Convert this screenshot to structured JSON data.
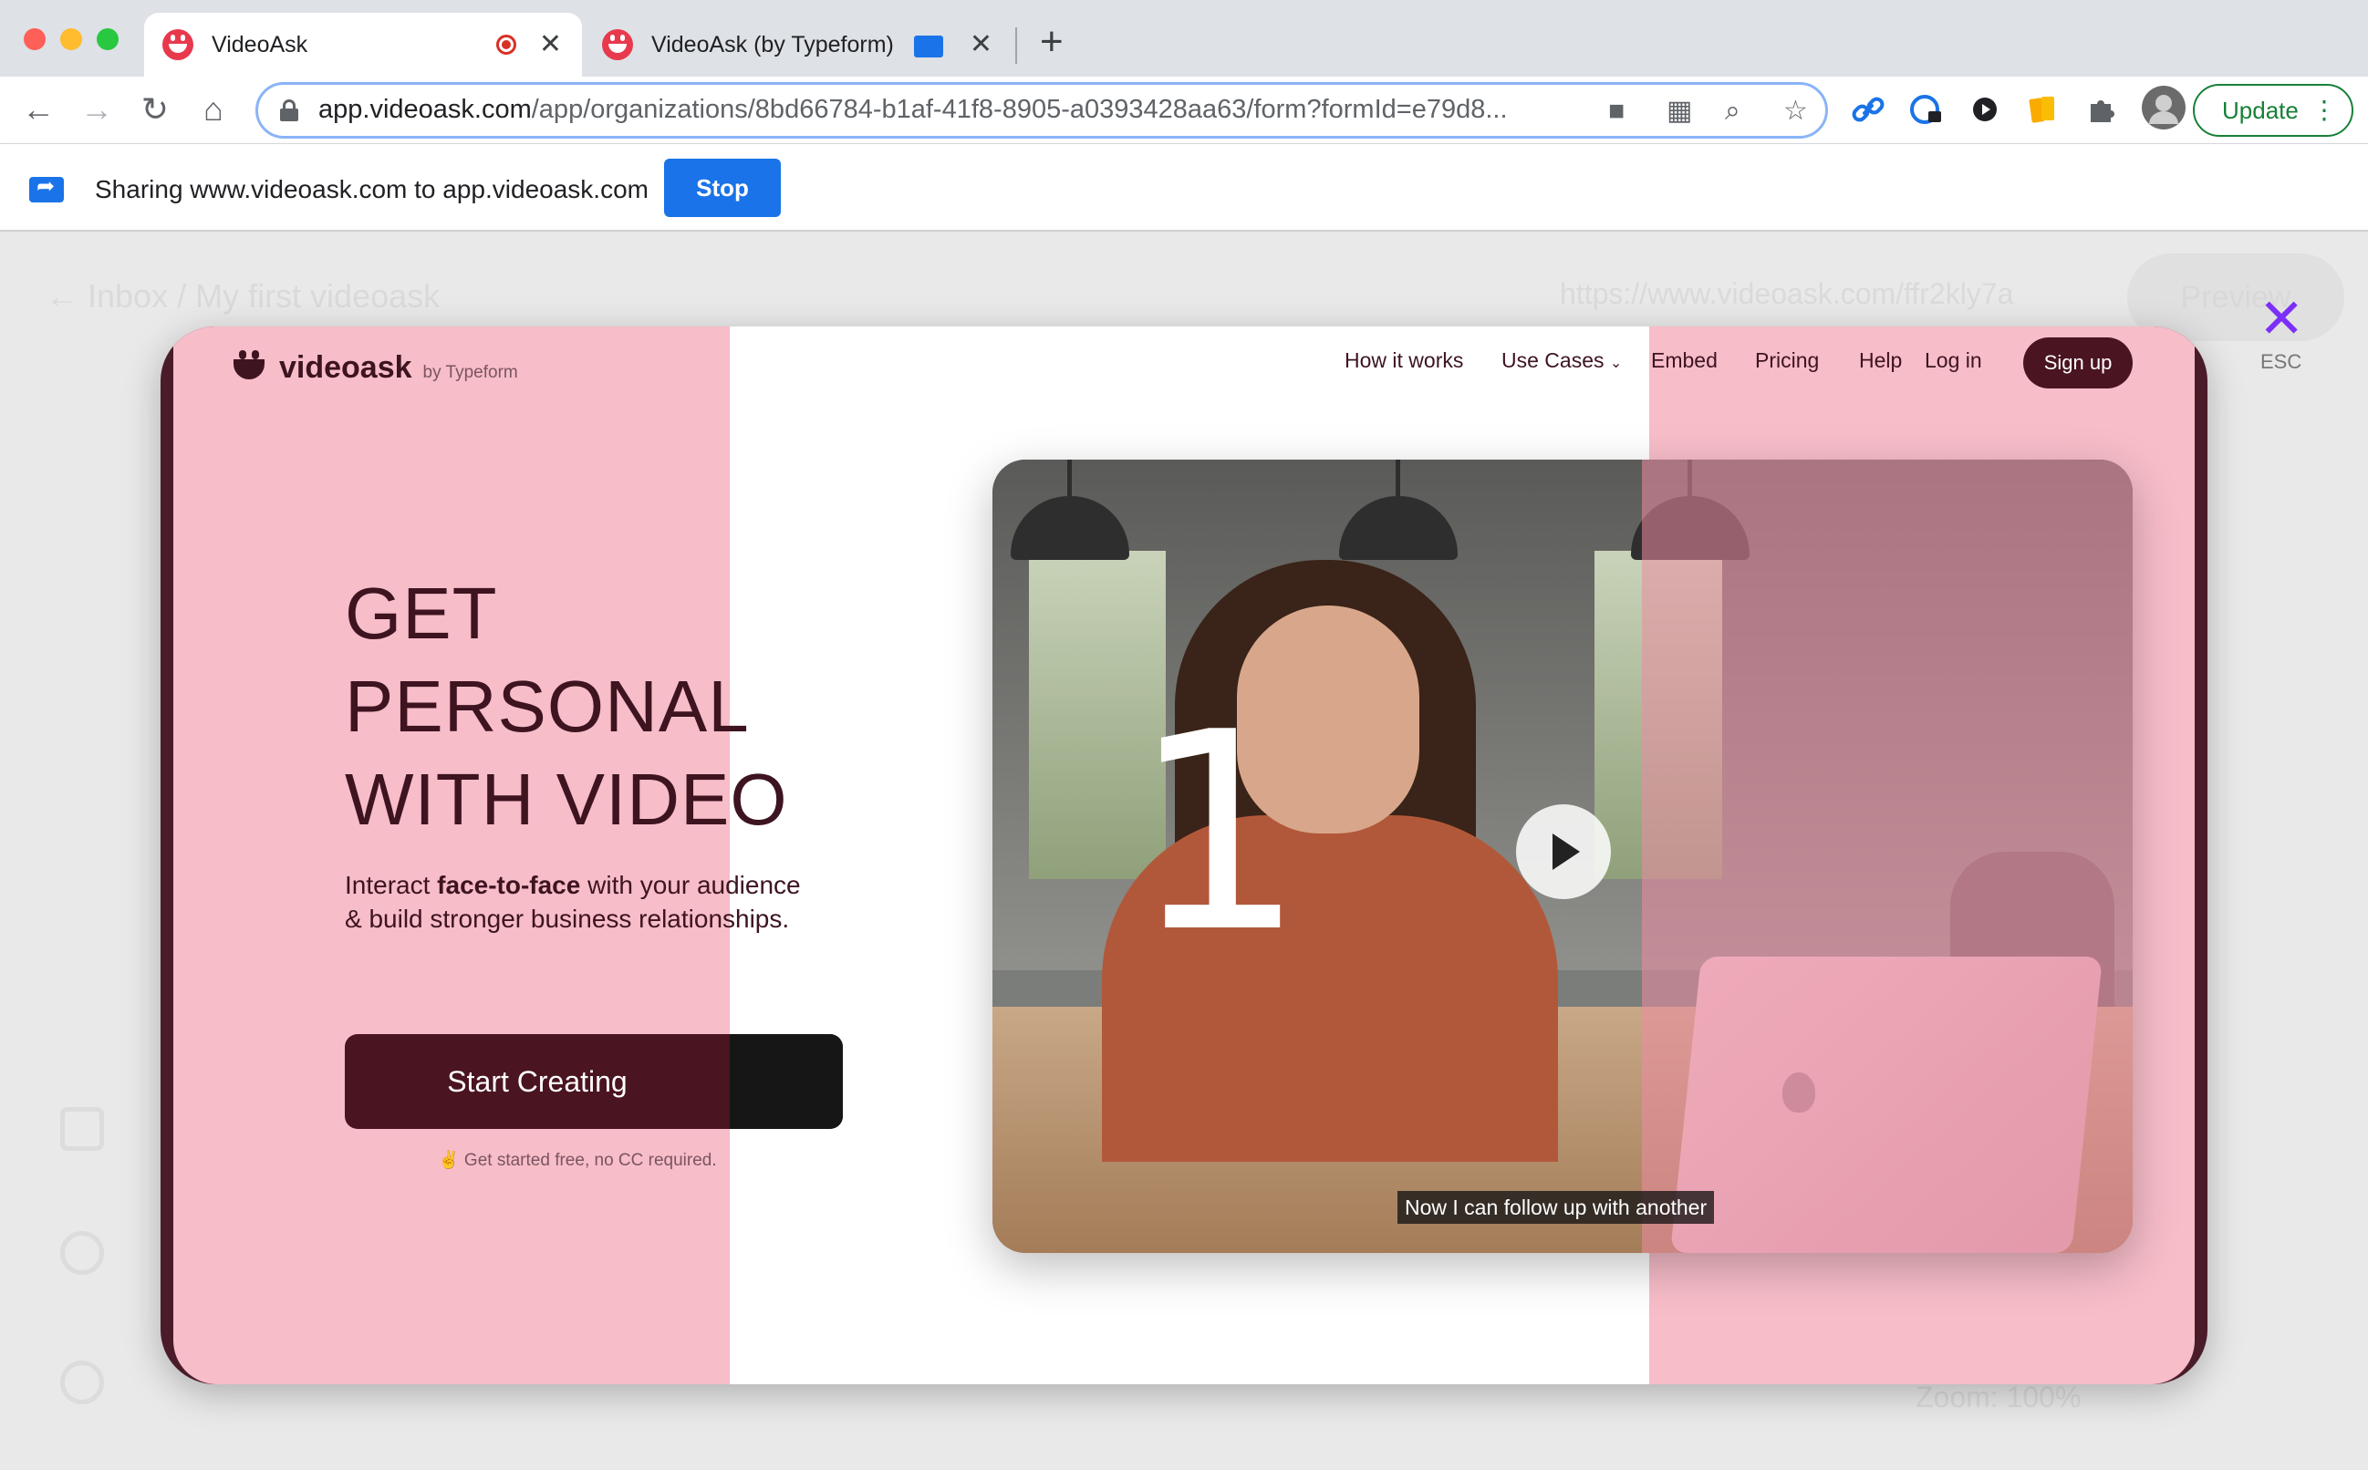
{
  "browser": {
    "tabs": [
      {
        "title": "VideoAsk",
        "active": true
      },
      {
        "title": "VideoAsk (by Typeform)",
        "active": false
      }
    ],
    "url": {
      "host": "app.videoask.com",
      "path": "/app/organizations/8bd66784-b1af-41f8-8905-a0393428aa63/form?formId=e79d8..."
    },
    "update_label": "Update"
  },
  "sharing_bar": {
    "text": "Sharing www.videoask.com to app.videoask.com",
    "stop_label": "Stop"
  },
  "background_app": {
    "breadcrumb": "← Inbox / My first videoask",
    "share_link": "https://www.videoask.com/ffr2kly7a",
    "preview_label": "Preview",
    "zoom_label": "Zoom: 100%"
  },
  "close": {
    "esc_label": "ESC"
  },
  "site": {
    "logo": {
      "word": "videoask",
      "by": "by Typeform"
    },
    "nav": [
      {
        "label": "How it works"
      },
      {
        "label": "Use Cases"
      },
      {
        "label": "Embed"
      },
      {
        "label": "Pricing"
      },
      {
        "label": "Help"
      }
    ],
    "login_label": "Log in",
    "signup_label": "Sign up",
    "hero_lines": [
      "GET",
      "PERSONAL",
      "WITH VIDEO"
    ],
    "sub_prefix": "Interact ",
    "sub_bold": "face-to-face",
    "sub_suffix": " with your audience & build stronger business relationships.",
    "cta_label": "Start Creating",
    "note": "✌️ Get started free, no CC required.",
    "video": {
      "countdown": "1",
      "caption": "Now I can follow up with another"
    }
  },
  "colors": {
    "brand_dark": "#4a1421",
    "brand_pink": "#f7bdc9",
    "chrome_blue": "#1a73e8",
    "update_green": "#188038",
    "close_purple": "#7b2ff7"
  }
}
